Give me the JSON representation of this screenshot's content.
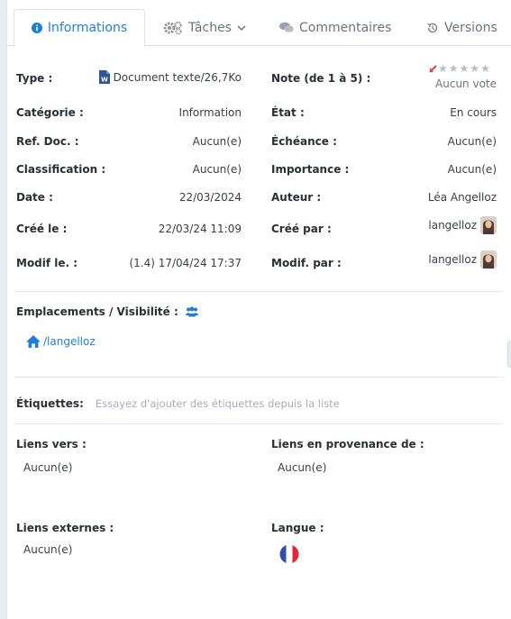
{
  "tabs": [
    {
      "label": "Informations",
      "icon": "info-icon"
    },
    {
      "label": "Tâches",
      "icon": "gears-icon"
    },
    {
      "label": "Commentaires",
      "icon": "comments-icon"
    },
    {
      "label": "Versions",
      "icon": "history-icon"
    }
  ],
  "fields": {
    "type_label": "Type :",
    "type_value": "Document texte/26,7Ko",
    "categorie_label": "Catégorie :",
    "categorie_value": "Information",
    "refdoc_label": "Ref. Doc. :",
    "refdoc_value": "Aucun(e)",
    "classification_label": "Classification :",
    "classification_value": "Aucun(e)",
    "date_label": "Date :",
    "date_value": "22/03/2024",
    "cree_le_label": "Créé le :",
    "cree_le_value": "22/03/24 11:09",
    "modif_le_label": "Modif le. :",
    "modif_le_value": "(1.4) 17/04/24 17:37",
    "note_label": "Note (de 1 à 5) :",
    "note_value": "Aucun vote",
    "etat_label": "État :",
    "etat_value": "En cours",
    "echeance_label": "Échéance :",
    "echeance_value": "Aucun(e)",
    "importance_label": "Importance :",
    "importance_value": "Aucun(e)",
    "auteur_label": "Auteur :",
    "auteur_value": "Léa Angelloz",
    "cree_par_label": "Créé par :",
    "cree_par_value": "langelloz",
    "modif_par_label": "Modif. par :",
    "modif_par_value": "langelloz"
  },
  "emplacements": {
    "label": "Emplacements / Visibilité :",
    "path": "/langelloz"
  },
  "etiquettes": {
    "label": "Étiquettes:",
    "placeholder": "Essayez d'ajouter des étiquettes depuis la liste"
  },
  "liens": {
    "vers_label": "Liens vers :",
    "vers_value": "Aucun(e)",
    "provenance_label": "Liens en provenance de :",
    "provenance_value": "Aucun(e)",
    "externes_label": "Liens externes :",
    "externes_value": "Aucun(e)",
    "langue_label": "Langue :"
  },
  "colors": {
    "accent": "#1f7fd6",
    "word_blue": "#2b5797",
    "star_gray": "#b9bdc4",
    "clear_red": "#e03b3b"
  }
}
